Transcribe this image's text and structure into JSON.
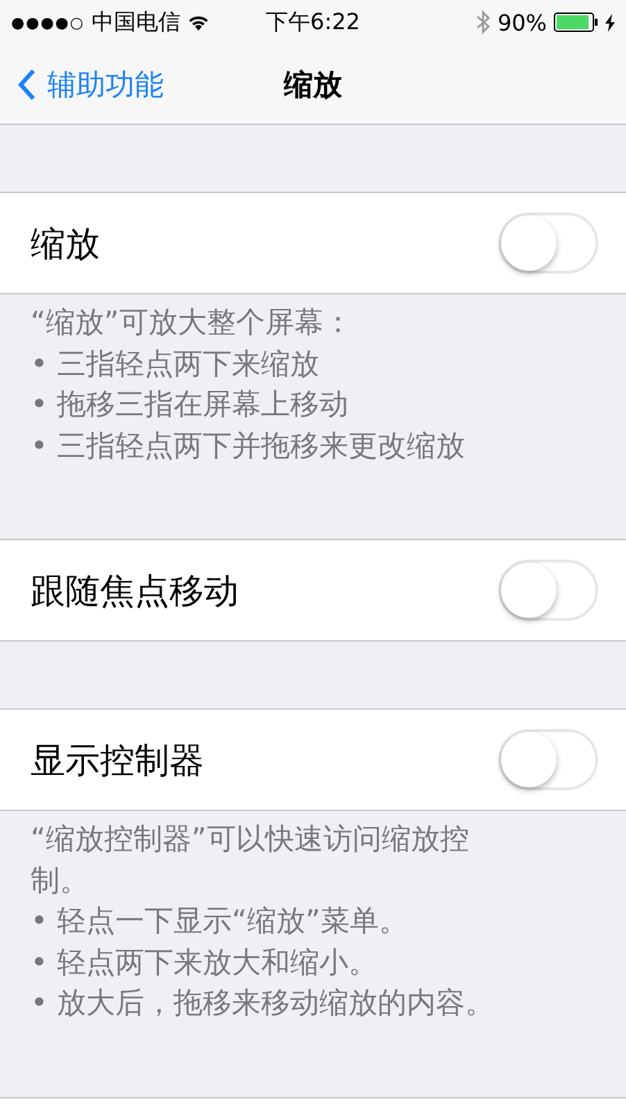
{
  "status_bar": {
    "signal": "●●●●○",
    "carrier": "中国电信",
    "time": "下午6:22",
    "battery_percent": "90%"
  },
  "nav_bar": {
    "back_label": "辅助功能",
    "title": "缩放"
  },
  "sections": [
    {
      "kind": "toggle",
      "label": "缩放",
      "on": false
    },
    {
      "kind": "footer",
      "lines": [
        "“缩放”可放大整个屏幕：",
        "•  三指轻点两下来缩放",
        "•  拖移三指在屏幕上移动",
        "•  三指轻点两下并拖移来更改缩放"
      ]
    },
    {
      "kind": "toggle",
      "label": "跟随焦点移动",
      "on": false
    },
    {
      "kind": "toggle",
      "label": "显示控制器",
      "on": false
    },
    {
      "kind": "footer",
      "lines": [
        "“缩放控制器”可以快速访问缩放控制。",
        "• 轻点一下显示“缩放”菜单。",
        "• 轻点两下来放大和缩小。",
        "• 放大后，拖移来移动缩放的内容。"
      ]
    }
  ]
}
